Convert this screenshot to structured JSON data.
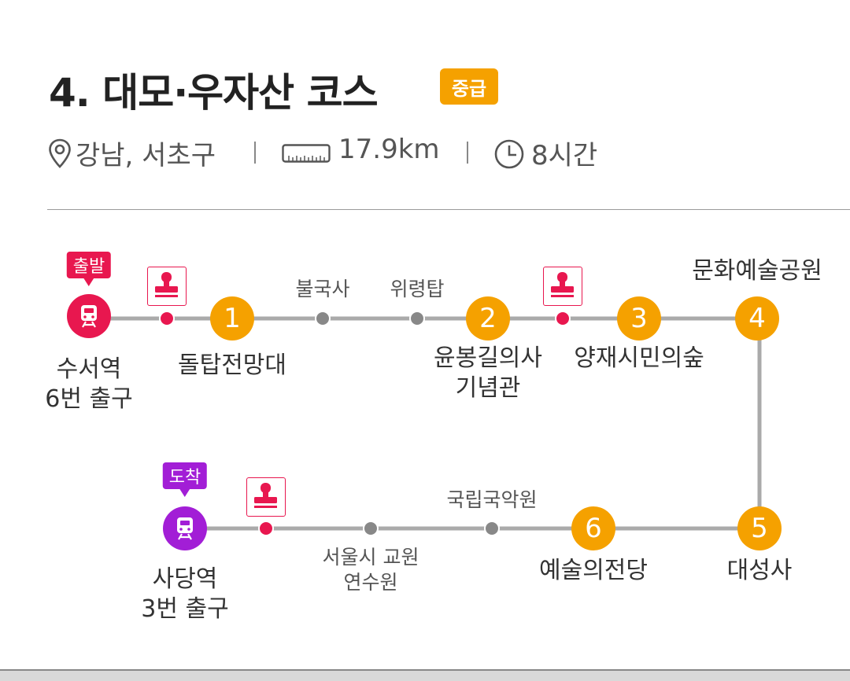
{
  "header": {
    "title": "4. 대모·우자산 코스",
    "level": "중급",
    "location": "강남, 서초구",
    "distance": "17.9km",
    "duration": "8시간"
  },
  "course": {
    "start_tag": "출발",
    "end_tag": "도착",
    "start_station": [
      "수서역",
      "6번 출구"
    ],
    "end_station": [
      "사당역",
      "3번 출구"
    ],
    "checkpoints": [
      {
        "num": "1",
        "name": [
          "돌탑전망대"
        ]
      },
      {
        "num": "2",
        "name": [
          "윤봉길의사",
          "기념관"
        ]
      },
      {
        "num": "3",
        "name": [
          "양재시민의숲"
        ]
      },
      {
        "num": "4",
        "name": [
          "문화예술공원"
        ]
      },
      {
        "num": "5",
        "name": [
          "대성사"
        ]
      },
      {
        "num": "6",
        "name": [
          "예술의전당"
        ]
      }
    ],
    "waypoints": [
      "불국사",
      "위령탑",
      "국립국악원",
      "서울시 교원연수원"
    ]
  },
  "colors": {
    "accent": "#f5a100",
    "start": "#e8174f",
    "end": "#a21ed6",
    "stamp": "#e8174f",
    "line": "#aaaaaa",
    "waypoint": "#888888"
  }
}
